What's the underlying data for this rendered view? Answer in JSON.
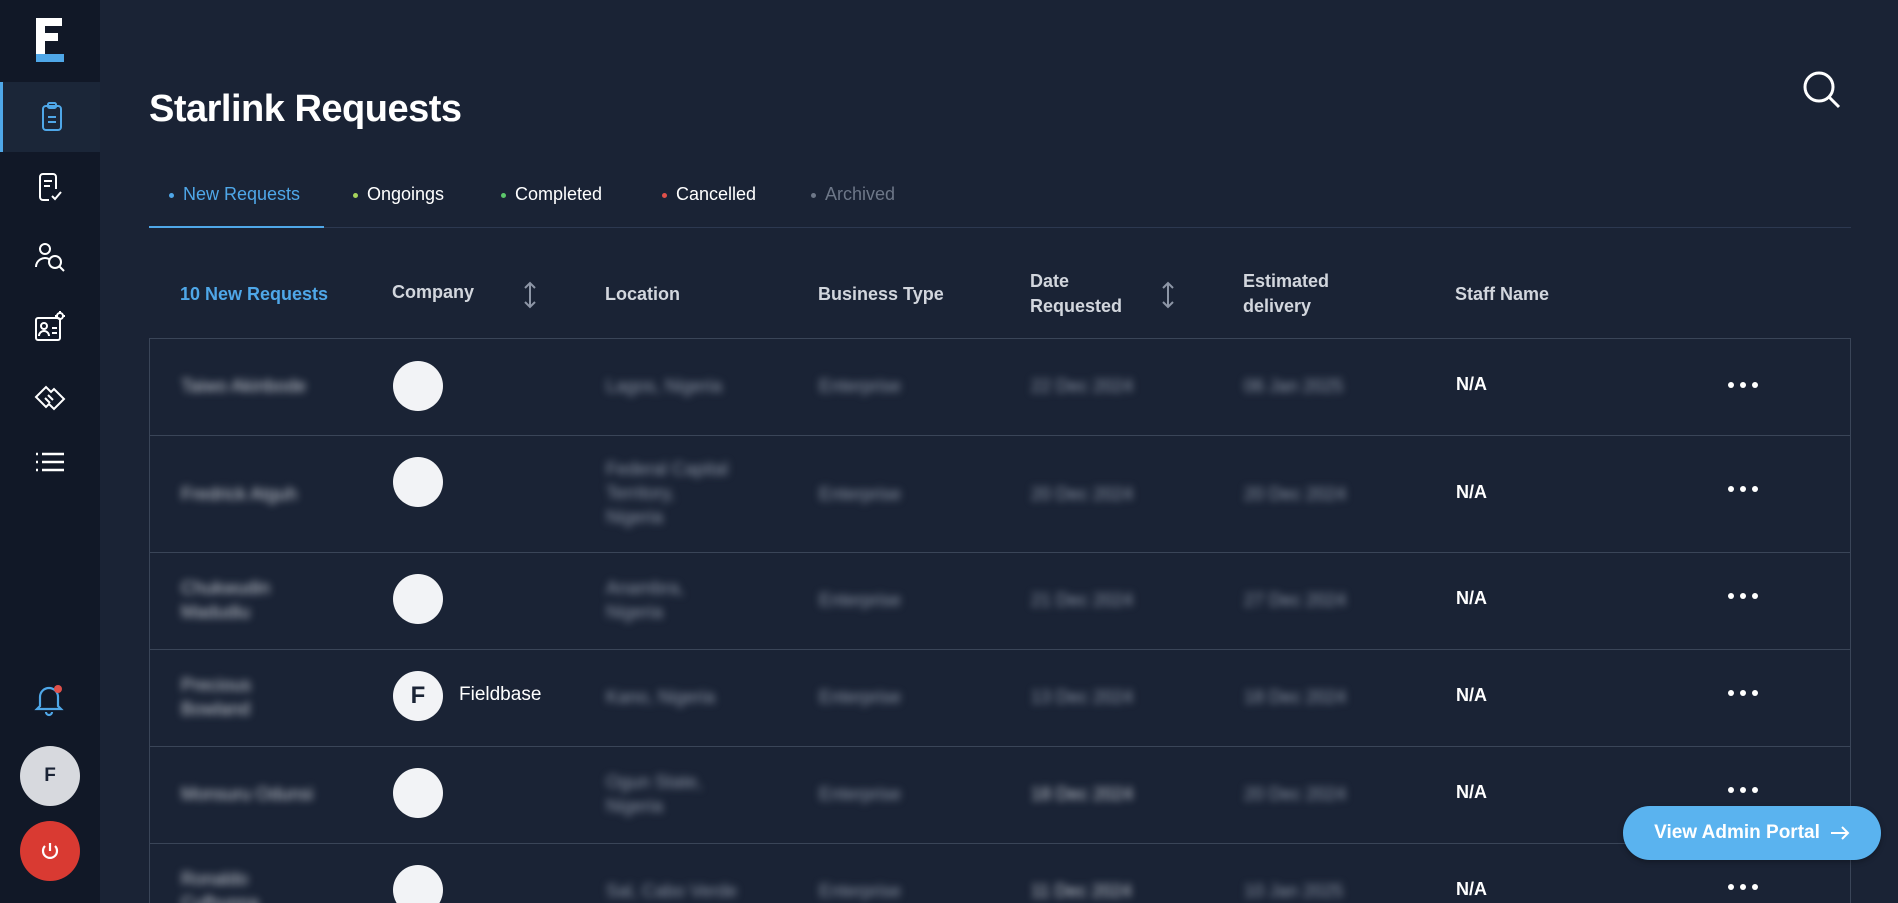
{
  "app": {
    "logo_letter": "F",
    "brand_color": "#4fa7e8"
  },
  "sidebar": {
    "items": [
      {
        "icon": "clipboard-icon",
        "active": true
      },
      {
        "icon": "document-check-icon",
        "active": false
      },
      {
        "icon": "user-search-icon",
        "active": false
      },
      {
        "icon": "contact-settings-icon",
        "active": false
      },
      {
        "icon": "handshake-icon",
        "active": false
      },
      {
        "icon": "list-icon",
        "active": false
      }
    ],
    "avatar_initial": "F"
  },
  "header": {
    "title": "Starlink Requests"
  },
  "tabs": [
    {
      "label": "New Requests",
      "dot_color": "#4fa7e8",
      "active": true
    },
    {
      "label": "Ongoings",
      "dot_color": "#a6d35b",
      "active": false
    },
    {
      "label": "Completed",
      "dot_color": "#5cc76b",
      "active": false
    },
    {
      "label": "Cancelled",
      "dot_color": "#e0504a",
      "active": false
    },
    {
      "label": "Archived",
      "dot_color": "#6d7788",
      "active": false
    }
  ],
  "table": {
    "count_label": "10 New Requests",
    "columns": {
      "company": "Company",
      "location": "Location",
      "business_type": "Business Type",
      "date_requested_1": "Date",
      "date_requested_2": "Requested",
      "estimated_delivery_1": "Estimated",
      "estimated_delivery_2": "delivery",
      "staff_name": "Staff Name"
    },
    "rows": [
      {
        "name": [
          "Taiwo Akinbode"
        ],
        "company_initial": "",
        "company": "",
        "location": [
          "Lagos, Nigeria"
        ],
        "business_type": "Enterprise",
        "date_requested": "22 Dec 2024",
        "estimated_delivery": "06 Jan 2025",
        "staff_name": "N/A"
      },
      {
        "name": [
          "Fredrick Atguh"
        ],
        "company_initial": "",
        "company": "",
        "location": [
          "Federal Capital",
          "Territory,",
          "Nigeria"
        ],
        "business_type": "Enterprise",
        "date_requested": "20 Dec 2024",
        "estimated_delivery": "20 Dec 2024",
        "staff_name": "N/A"
      },
      {
        "name": [
          "Chukwudin",
          "Madudiu"
        ],
        "company_initial": "",
        "company": "",
        "location": [
          "Anambra,",
          "Nigeria"
        ],
        "business_type": "Enterprise",
        "date_requested": "21 Dec 2024",
        "estimated_delivery": "27 Dec 2024",
        "staff_name": "N/A"
      },
      {
        "name": [
          "Precious",
          "Bowland"
        ],
        "company_initial": "F",
        "company": "Fieldbase",
        "location": [
          "Kano, Nigeria"
        ],
        "business_type": "Enterprise",
        "date_requested": "13 Dec 2024",
        "estimated_delivery": "18 Dec 2024",
        "staff_name": "N/A"
      },
      {
        "name": [
          "Monsuru Odunsi"
        ],
        "company_initial": "",
        "company": "",
        "location": [
          "Ogun State,",
          "Nigeria"
        ],
        "business_type": "Enterprise",
        "date_requested": "18 Dec 2024",
        "estimated_delivery": "20 Dec 2024",
        "staff_name": "N/A"
      },
      {
        "name": [
          "Ronaldo",
          "Cufhunna"
        ],
        "company_initial": "",
        "company": "",
        "location": [
          "Sal, Cabo Verde"
        ],
        "business_type": "Enterprise",
        "date_requested": "11 Dec 2024",
        "estimated_delivery": "10 Jan 2025",
        "staff_name": "N/A"
      }
    ]
  },
  "admin_button": {
    "label": "View Admin Portal"
  }
}
